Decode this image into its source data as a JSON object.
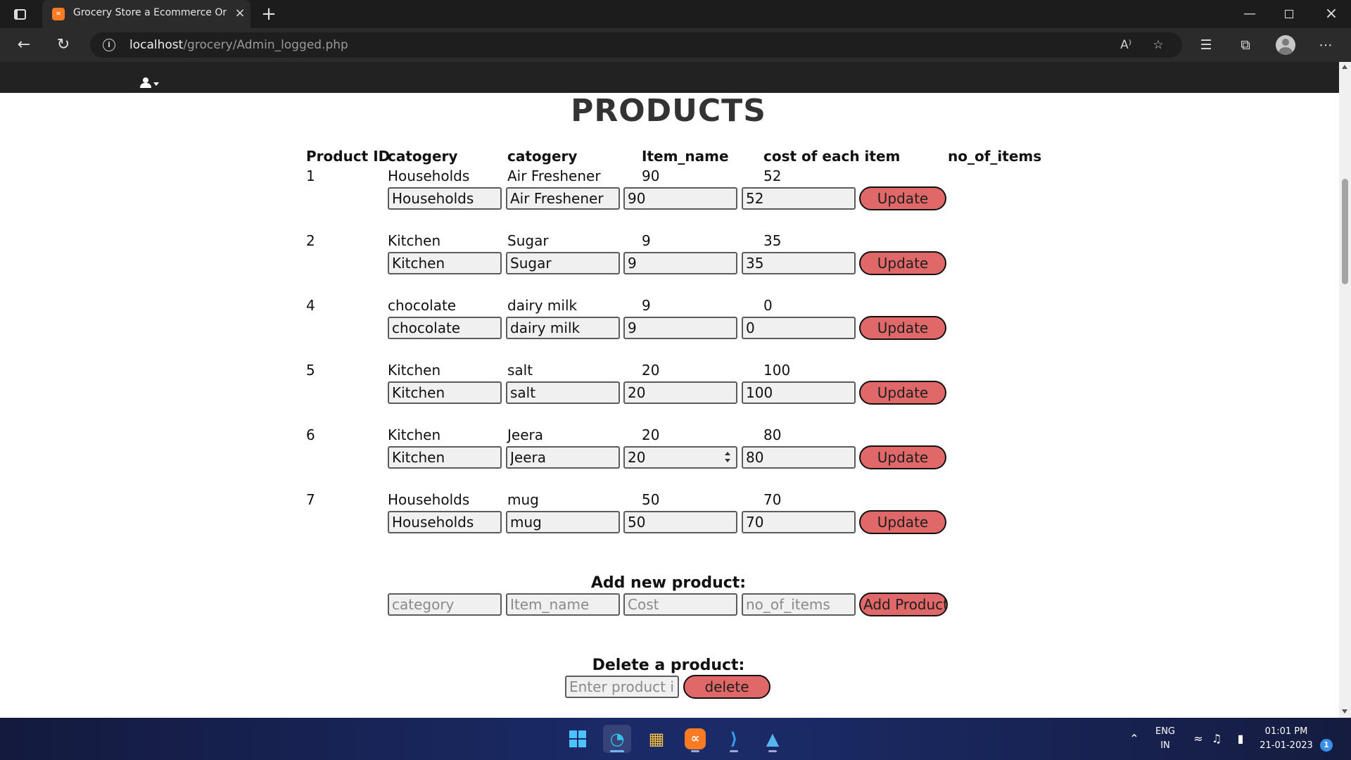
{
  "browser": {
    "tab_title": "Grocery Store a Ecommerce Onli",
    "url_host": "localhost",
    "url_path": "/grocery/Admin_logged.php"
  },
  "page": {
    "title": "PRODUCTS",
    "headers": {
      "product_id": "Product ID",
      "category": "catogery",
      "item": "catogery",
      "item_name": "Item_name",
      "cost": "cost of each item",
      "no_of_items": "no_of_items"
    },
    "products": [
      {
        "id": "1",
        "category": "Households",
        "item": "Air Freshener",
        "item_name": "90",
        "cost": "52",
        "update_label": "Update"
      },
      {
        "id": "2",
        "category": "Kitchen",
        "item": "Sugar",
        "item_name": "9",
        "cost": "35",
        "update_label": "Update"
      },
      {
        "id": "4",
        "category": "chocolate",
        "item": "dairy milk",
        "item_name": "9",
        "cost": "0",
        "update_label": "Update"
      },
      {
        "id": "5",
        "category": "Kitchen",
        "item": "salt",
        "item_name": "20",
        "cost": "100",
        "update_label": "Update"
      },
      {
        "id": "6",
        "category": "Kitchen",
        "item": "Jeera",
        "item_name": "20",
        "cost": "80",
        "update_label": "Update"
      },
      {
        "id": "7",
        "category": "Households",
        "item": "mug",
        "item_name": "50",
        "cost": "70",
        "update_label": "Update"
      }
    ],
    "add_product": {
      "title": "Add new product:",
      "category_placeholder": "category",
      "item_name_placeholder": "Item_name",
      "cost_placeholder": "Cost",
      "no_of_items_placeholder": "no_of_items",
      "button_label": "Add Product"
    },
    "delete_product": {
      "title": "Delete a product:",
      "id_placeholder": "Enter product id",
      "button_label": "delete"
    }
  },
  "taskbar": {
    "language": "ENG",
    "region": "IN",
    "time": "01:01 PM",
    "date": "21-01-2023",
    "notification_count": "1"
  },
  "colors": {
    "button_bg": "#e06868",
    "nav_bg": "#222222",
    "field_bg": "#f0f0f0"
  }
}
